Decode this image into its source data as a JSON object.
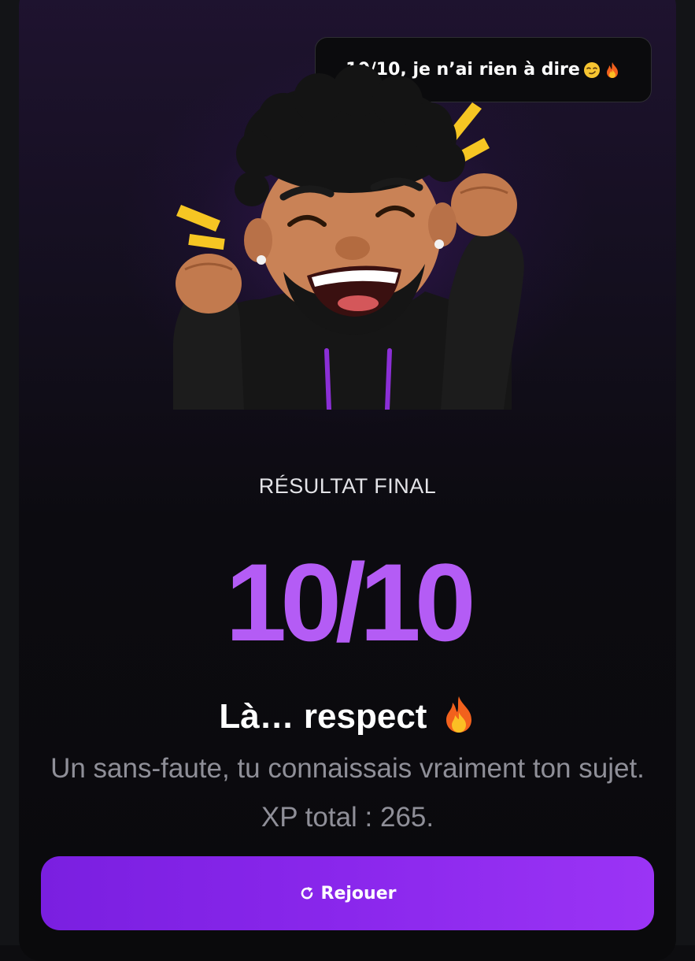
{
  "bubble": {
    "text": "10/10, je n’ai rien à dire",
    "emojis": [
      "smirk-emoji-icon",
      "fire-emoji-icon"
    ]
  },
  "avatar": {
    "icon": "celebrating-memoji-avatar"
  },
  "result": {
    "label": "RÉSULTAT FINAL",
    "score": "10/10",
    "headline": "Là… respect",
    "headline_emoji": "fire-emoji-icon",
    "subtitle": "Un sans-faute, tu connaissais vraiment ton sujet. XP total : 265."
  },
  "actions": {
    "replay_label": "Rejouer",
    "replay_icon": "refresh-icon"
  },
  "colors": {
    "accent": "#b45cf5",
    "button_start": "#7a1fe0",
    "button_end": "#9b34f5",
    "background": "#0a0a0c"
  }
}
